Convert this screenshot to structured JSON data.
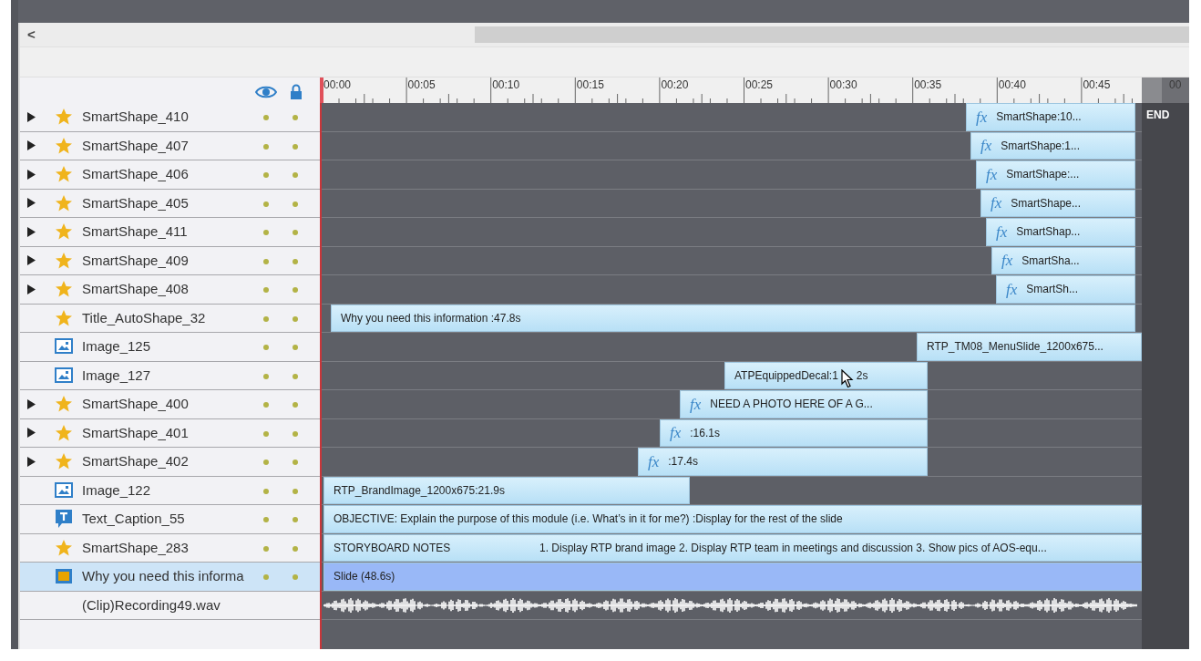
{
  "scrollbar": {
    "left_arrow": "<"
  },
  "ruler": {
    "ticks": [
      "00:00",
      "00:05",
      "00:10",
      "00:15",
      "00:20",
      "00:25",
      "00:30",
      "00:35",
      "00:40",
      "00:45"
    ],
    "overflow_tick": "00"
  },
  "end_label": "END",
  "rows": [
    {
      "name": "SmartShape_410",
      "kind": "star",
      "expandable": true,
      "selected": false,
      "bar": {
        "effect": "fx",
        "labels": [
          "SmartShape:10..."
        ]
      }
    },
    {
      "name": "SmartShape_407",
      "kind": "star",
      "expandable": true,
      "selected": false,
      "bar": {
        "effect": "fx",
        "labels": [
          "SmartShape:1..."
        ]
      }
    },
    {
      "name": "SmartShape_406",
      "kind": "star",
      "expandable": true,
      "selected": false,
      "bar": {
        "effect": "fx",
        "labels": [
          "SmartShape:..."
        ]
      }
    },
    {
      "name": "SmartShape_405",
      "kind": "star",
      "expandable": true,
      "selected": false,
      "bar": {
        "effect": "fx",
        "labels": [
          "SmartShape..."
        ]
      }
    },
    {
      "name": "SmartShape_411",
      "kind": "star",
      "expandable": true,
      "selected": false,
      "bar": {
        "effect": "fx",
        "labels": [
          "SmartShap..."
        ]
      }
    },
    {
      "name": "SmartShape_409",
      "kind": "star",
      "expandable": true,
      "selected": false,
      "bar": {
        "effect": "fx",
        "labels": [
          "SmartSha..."
        ]
      }
    },
    {
      "name": "SmartShape_408",
      "kind": "star",
      "expandable": true,
      "selected": false,
      "bar": {
        "effect": "fx",
        "labels": [
          "SmartSh..."
        ]
      }
    },
    {
      "name": "Title_AutoShape_32",
      "kind": "star",
      "expandable": false,
      "selected": false,
      "bar": {
        "labels": [
          "Why you need this information :47.8s"
        ]
      }
    },
    {
      "name": "Image_125",
      "kind": "image",
      "expandable": false,
      "selected": false,
      "bar": {
        "labels": [
          "RTP_TM08_MenuSlide_1200x675..."
        ]
      }
    },
    {
      "name": "Image_127",
      "kind": "image",
      "expandable": false,
      "selected": false,
      "bar": {
        "labels": [
          "ATPEquippedDecal:1",
          "2s"
        ]
      }
    },
    {
      "name": "SmartShape_400",
      "kind": "star",
      "expandable": true,
      "selected": false,
      "bar": {
        "effect": "fx",
        "labels": [
          "NEED A PHOTO HERE OF A G..."
        ]
      }
    },
    {
      "name": "SmartShape_401",
      "kind": "star",
      "expandable": true,
      "selected": false,
      "bar": {
        "effect": "fx",
        "labels": [
          ":16.1s"
        ]
      }
    },
    {
      "name": "SmartShape_402",
      "kind": "star",
      "expandable": true,
      "selected": false,
      "bar": {
        "effect": "fx",
        "labels": [
          ":17.4s"
        ]
      }
    },
    {
      "name": "Image_122",
      "kind": "image",
      "expandable": false,
      "selected": false,
      "bar": {
        "labels": [
          "RTP_BrandImage_1200x675:21.9s"
        ]
      }
    },
    {
      "name": "Text_Caption_55",
      "kind": "caption",
      "expandable": false,
      "selected": false,
      "bar": {
        "labels": [
          "OBJECTIVE: Explain the purpose of this module (i.e. What’s in it for me?) :Display for the rest of the slide"
        ]
      }
    },
    {
      "name": "SmartShape_283",
      "kind": "star",
      "expandable": false,
      "selected": false,
      "bar": {
        "labels": [
          "STORYBOARD NOTES",
          "1. Display RTP brand image  2. Display RTP team in meetings and discussion  3. Show pics of AOS-equ..."
        ]
      }
    },
    {
      "name": "Why you need this informa",
      "kind": "slide",
      "expandable": false,
      "selected": true,
      "bar": {
        "labels": [
          "Slide (48.6s)"
        ]
      }
    },
    {
      "name": "(Clip)Recording49.wav",
      "kind": "audio",
      "expandable": false,
      "selected": false
    }
  ]
}
